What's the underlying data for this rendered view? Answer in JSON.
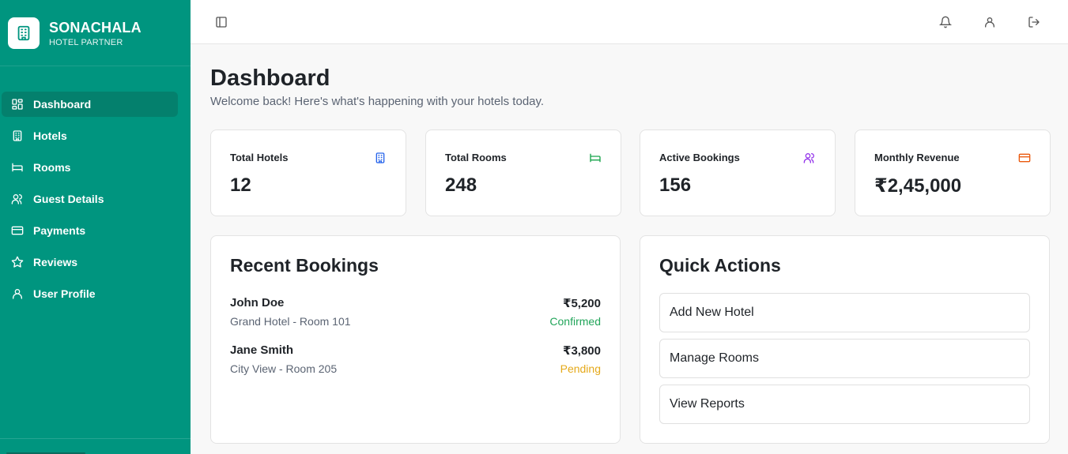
{
  "brand": {
    "name": "SONACHALA",
    "subtitle": "HOTEL PARTNER",
    "icon": "hotel-building-icon"
  },
  "sidebar": {
    "items": [
      {
        "label": "Dashboard",
        "icon": "dashboard-grid-icon",
        "active": true
      },
      {
        "label": "Hotels",
        "icon": "hotel-building-icon"
      },
      {
        "label": "Rooms",
        "icon": "bed-icon"
      },
      {
        "label": "Guest Details",
        "icon": "users-icon"
      },
      {
        "label": "Payments",
        "icon": "credit-card-icon"
      },
      {
        "label": "Reviews",
        "icon": "star-icon"
      },
      {
        "label": "User Profile",
        "icon": "user-icon"
      }
    ]
  },
  "topbar": {
    "toggle_icon": "sidebar-toggle-icon",
    "bell_icon": "bell-icon",
    "user_icon": "user-icon",
    "logout_icon": "logout-icon"
  },
  "page": {
    "title": "Dashboard",
    "subtitle": "Welcome back! Here's what's happening with your hotels today."
  },
  "stats": [
    {
      "label": "Total Hotels",
      "value": "12",
      "icon": "hotel-building-icon",
      "color": "#2563eb"
    },
    {
      "label": "Total Rooms",
      "value": "248",
      "icon": "bed-icon",
      "color": "#16a34a"
    },
    {
      "label": "Active Bookings",
      "value": "156",
      "icon": "users-icon",
      "color": "#9333ea"
    },
    {
      "label": "Monthly Revenue",
      "value": "₹2,45,000",
      "icon": "credit-card-icon",
      "color": "#ea580c"
    }
  ],
  "recent_bookings": {
    "title": "Recent Bookings",
    "items": [
      {
        "name": "John Doe",
        "detail": "Grand Hotel - Room 101",
        "amount": "₹5,200",
        "status": "Confirmed",
        "status_color": "#22a55a"
      },
      {
        "name": "Jane Smith",
        "detail": "City View - Room 205",
        "amount": "₹3,800",
        "status": "Pending",
        "status_color": "#e5a91a"
      }
    ]
  },
  "quick_actions": {
    "title": "Quick Actions",
    "items": [
      {
        "label": "Add New Hotel"
      },
      {
        "label": "Manage Rooms"
      },
      {
        "label": "View Reports"
      }
    ]
  },
  "colors": {
    "sidebar": "#00957f",
    "sidebar_active": "#04806d"
  }
}
